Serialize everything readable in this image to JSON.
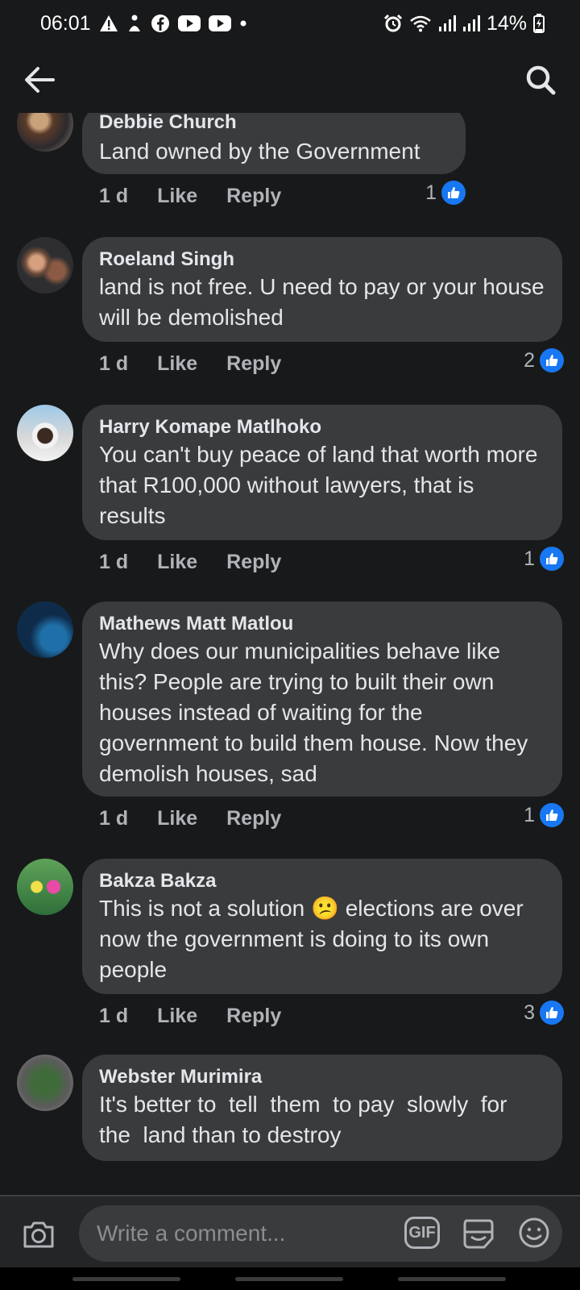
{
  "status_bar": {
    "time": "06:01",
    "battery": "14%"
  },
  "header": {
    "back_icon": "arrow-left-icon",
    "search_icon": "search-icon"
  },
  "comments": [
    {
      "author": "Debbie Church",
      "text": "Land owned by the Government",
      "time": "1 d",
      "like_label": "Like",
      "reply_label": "Reply",
      "likes": "1"
    },
    {
      "author": "Roeland Singh",
      "text": "land is not free. U need to pay or your house will be demolished",
      "time": "1 d",
      "like_label": "Like",
      "reply_label": "Reply",
      "likes": "2"
    },
    {
      "author": "Harry Komape Matlhoko",
      "text": "You can't buy peace of land that worth more that R100,000 without lawyers, that is results",
      "time": "1 d",
      "like_label": "Like",
      "reply_label": "Reply",
      "likes": "1"
    },
    {
      "author": "Mathews Matt Matlou",
      "text": "Why does our municipalities behave like this? People are trying to built their own houses instead of waiting for the government to build them house. Now they demolish houses, sad",
      "time": "1 d",
      "like_label": "Like",
      "reply_label": "Reply",
      "likes": "1"
    },
    {
      "author": "Bakza Bakza",
      "text_before": "This is not a solution",
      "emoji": "😕",
      "text_after": "elections are over now the government is doing to its own people",
      "time": "1 d",
      "like_label": "Like",
      "reply_label": "Reply",
      "likes": "3"
    },
    {
      "author": "Webster Murimira",
      "text": "It's better to  tell  them  to pay  slowly  for the  land than to destroy"
    }
  ],
  "composer": {
    "placeholder": "Write a comment...",
    "gif_label": "GIF"
  },
  "colors": {
    "background": "#18191a",
    "bubble": "#3a3b3c",
    "like_blue": "#1877f2",
    "secondary_text": "#b0b3b8"
  }
}
